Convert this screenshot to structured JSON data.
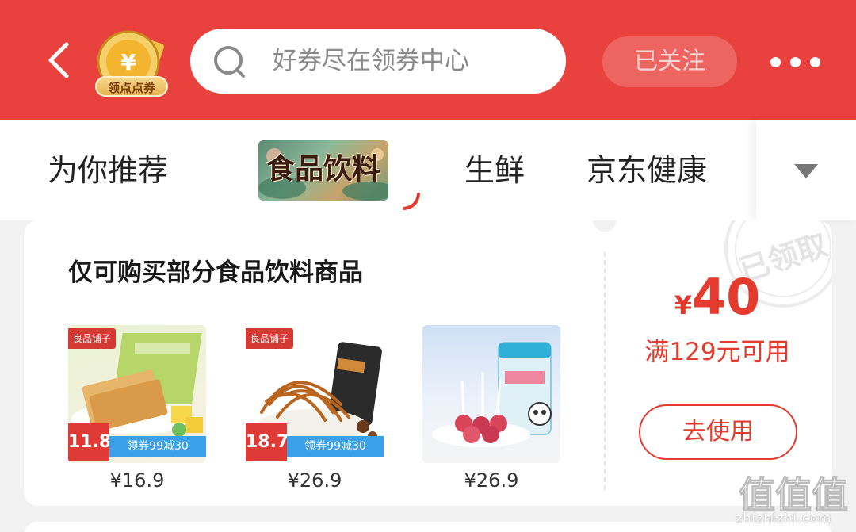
{
  "header": {
    "coin_label": "领点点券",
    "coin_symbol": "¥",
    "search_placeholder": "好券尽在领券中心",
    "follow_label": "已关注"
  },
  "tabs": [
    {
      "label": "为你推荐"
    },
    {
      "label": "食品饮料",
      "active": true
    },
    {
      "label": "生鲜"
    },
    {
      "label": "京东健康"
    }
  ],
  "coupon": {
    "title": "仅可购买部分食品饮料商品",
    "currency": "¥",
    "amount": "40",
    "condition": "满129元可用",
    "use_label": "去使用",
    "stamp_text": "已领取",
    "products": [
      {
        "brand": "良品铺子",
        "deal_price": "11.8",
        "promo": "领券99减30",
        "price": "¥16.9"
      },
      {
        "brand": "良品铺子",
        "deal_price": "18.7",
        "promo": "领券99减30",
        "price": "¥26.9"
      },
      {
        "brand": "",
        "deal_price": "",
        "promo": "",
        "price": "¥26.9"
      }
    ]
  },
  "watermark": {
    "logo": "值值值",
    "site": "zhizhizhi.com"
  },
  "colors": {
    "brand_red": "#e9423e",
    "coupon_red": "#e53b2e"
  }
}
